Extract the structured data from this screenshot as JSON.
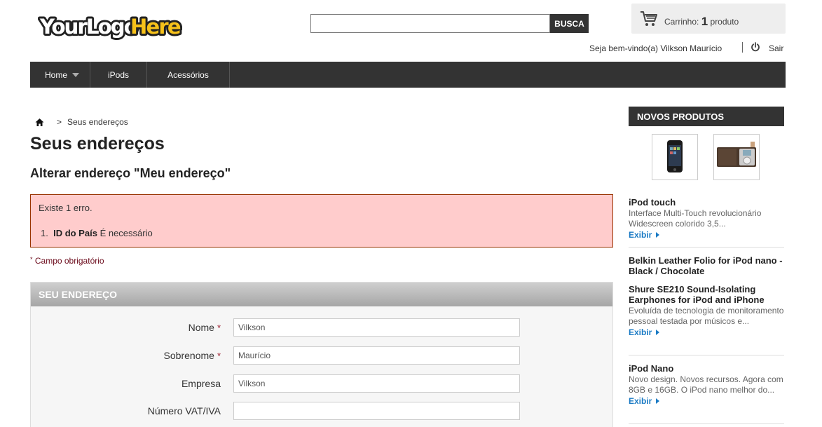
{
  "header": {
    "logo": {
      "part1": "YourLogo",
      "part2": "Here"
    },
    "search": {
      "value": "",
      "placeholder": "",
      "button_label": "BUSCA"
    },
    "cart": {
      "prefix": "Carrinho:",
      "count": "1",
      "suffix": "produto"
    },
    "welcome": "Seja bem-vindo(a) Vilkson Maurício",
    "logout_label": "Sair"
  },
  "nav": {
    "items": [
      {
        "label": "Home"
      },
      {
        "label": "iPods"
      },
      {
        "label": "Acessórios"
      }
    ]
  },
  "breadcrumb": {
    "current": "Seus endereços",
    "separator": ">"
  },
  "main": {
    "title": "Seus endereços",
    "subtitle": "Alterar endereço \"Meu endereço\"",
    "error": {
      "summary": "Existe 1 erro.",
      "item_number": "1.",
      "item_field": "ID do País",
      "item_message": "É necessário"
    },
    "required_note": "Campo obrigatório",
    "required_mark": "*",
    "form": {
      "header": "SEU ENDEREÇO",
      "fields": [
        {
          "label": "Nome",
          "value": "Vilkson",
          "required": "*"
        },
        {
          "label": "Sobrenome",
          "value": "Maurício",
          "required": "*"
        },
        {
          "label": "Empresa",
          "value": "Vilkson",
          "required": ""
        },
        {
          "label": "Número VAT/IVA",
          "value": "",
          "required": ""
        }
      ]
    }
  },
  "sidebar": {
    "title": "NOVOS PRODUTOS",
    "products": [
      {
        "name": "iPod touch",
        "desc": "Interface Multi-Touch revolucionário Widescreen colorido 3,5...",
        "more": "Exibir"
      },
      {
        "name": "Belkin Leather Folio for iPod nano - Black / Chocolate",
        "desc": "",
        "more": ""
      },
      {
        "name": "Shure SE210 Sound-Isolating Earphones for iPod and iPhone",
        "desc": "Evoluída de tecnologia de monitoramento pessoal testada por músicos e...",
        "more": "Exibir"
      },
      {
        "name": "iPod Nano",
        "desc": "Novo design. Novos recursos. Agora com 8GB e 16GB. O iPod nano melhor do...",
        "more": "Exibir"
      }
    ]
  },
  "colors": {
    "nav_bg": "#333333",
    "error_bg": "#ffcccc",
    "error_border": "#993300",
    "link_blue": "#1a7ac4",
    "logo_yellow": "#f7c21a"
  }
}
